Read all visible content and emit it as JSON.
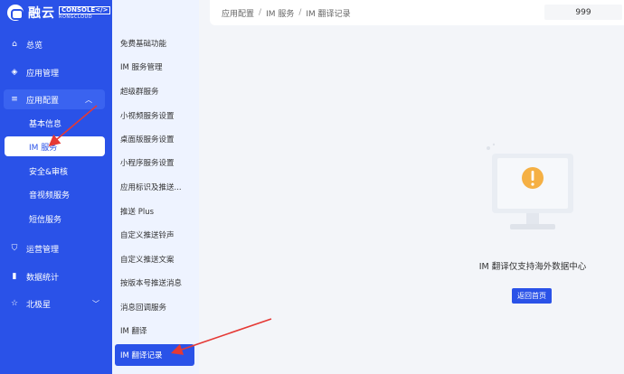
{
  "logo": {
    "name": "融云",
    "console": "CONSOLE</>",
    "sub": "RONGCLOUD"
  },
  "sidebar": {
    "items": [
      {
        "label": "总览",
        "icon": "home-icon"
      },
      {
        "label": "应用管理",
        "icon": "layers-icon"
      },
      {
        "label": "应用配置",
        "icon": "sliders-icon",
        "expanded": true
      },
      {
        "label": "运营管理",
        "icon": "shield-icon"
      },
      {
        "label": "数据统计",
        "icon": "bar-chart-icon"
      },
      {
        "label": "北极星",
        "icon": "star-icon"
      }
    ],
    "sub_items": [
      "基本信息",
      "IM 服务",
      "安全&审核",
      "音视频服务",
      "短信服务"
    ],
    "active_sub": "IM 服务"
  },
  "subnav": {
    "items": [
      "免费基础功能",
      "IM 服务管理",
      "超级群服务",
      "小视频服务设置",
      "桌面版服务设置",
      "小程序服务设置",
      "应用标识及推送...",
      "推送 Plus",
      "自定义推送铃声",
      "自定义推送文案",
      "按版本号推送消息",
      "消息回调服务",
      "IM 翻译",
      "IM 翻译记录"
    ],
    "active": "IM 翻译记录"
  },
  "breadcrumb": [
    "应用配置",
    "IM 服务",
    "IM 翻译记录"
  ],
  "app_id": "999",
  "empty": {
    "message": "IM 翻译仅支持海外数据中心",
    "button": "返回首页"
  },
  "colors": {
    "primary": "#2a52e8",
    "subnav_bg": "#eef3ff",
    "page_bg": "#f3f5f9",
    "warning": "#f5b044",
    "annotation": "#e53935"
  }
}
